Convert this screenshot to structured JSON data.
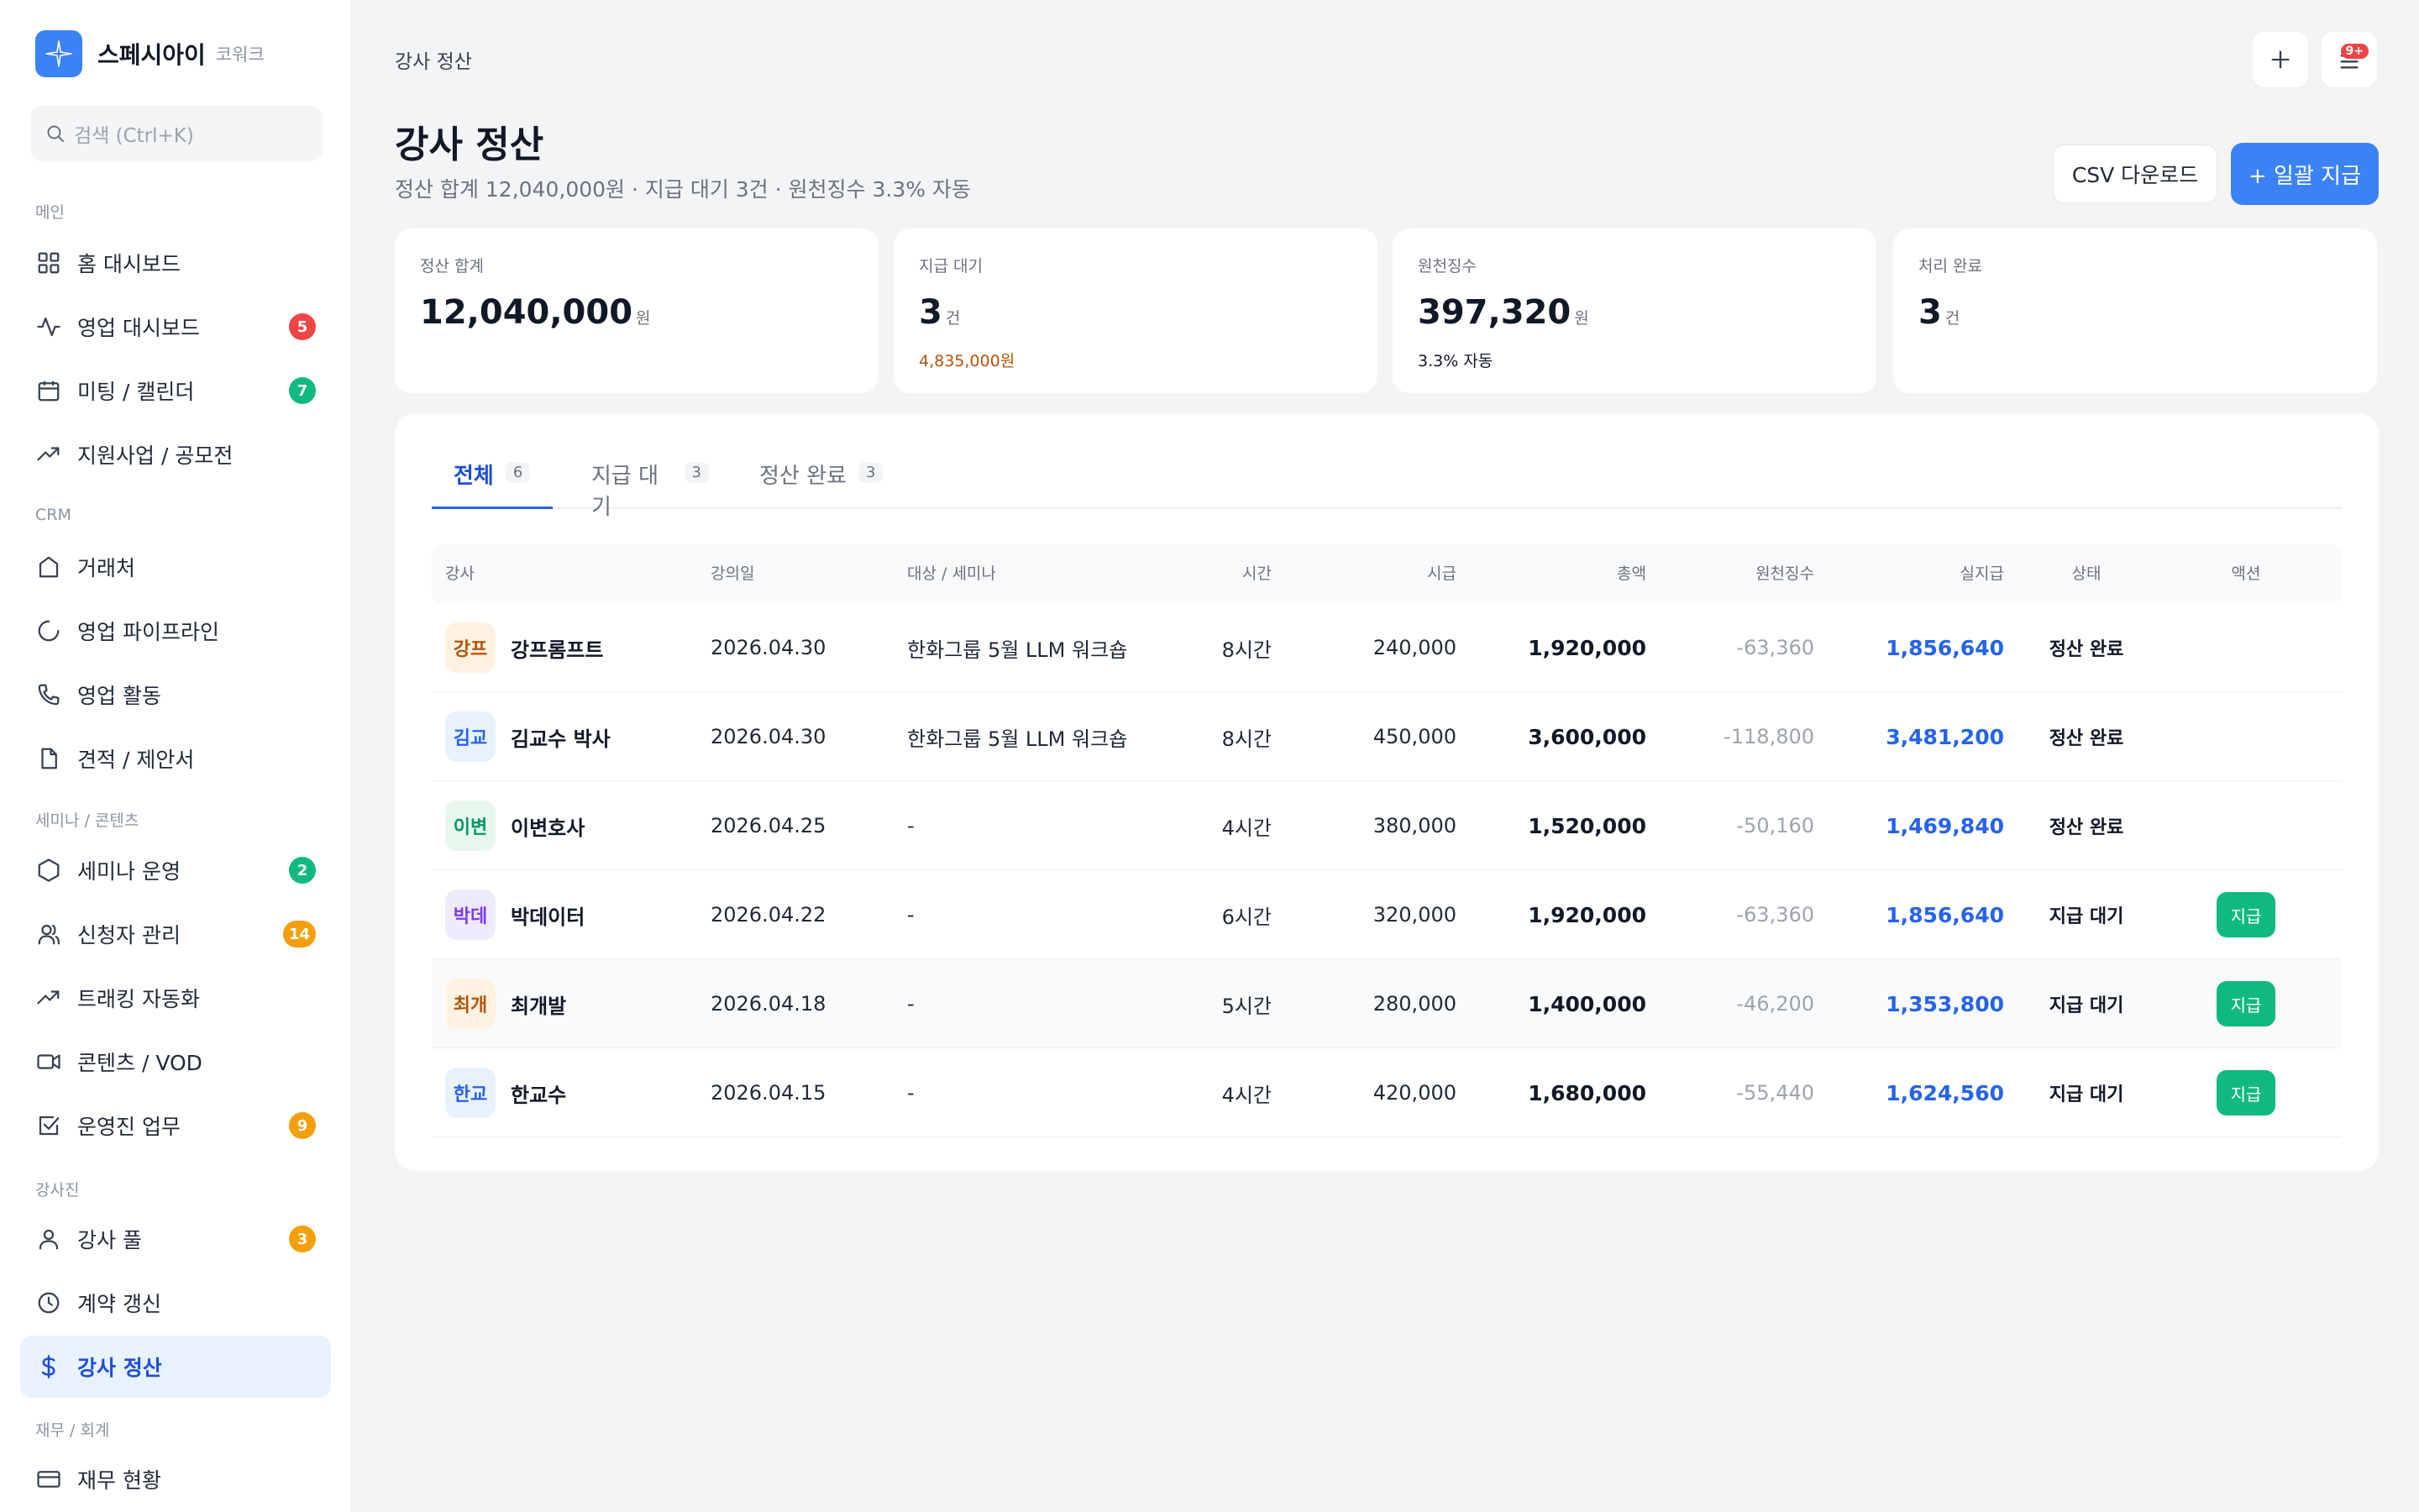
{
  "colors": {
    "accent": "#3b82f6",
    "active_bg": "#e8f1fe",
    "badge_red": "#ef4444",
    "badge_green": "#10b981",
    "badge_orange": "#f59e0b",
    "pay_green": "#10b981",
    "link_blue": "#2563eb"
  },
  "sidebar": {
    "brand": {
      "name": "스페시아이",
      "sub": "코워크",
      "icon": "sparkle-logo-icon"
    },
    "search": {
      "placeholder": "검색 (Ctrl+K)",
      "icon": "search-icon"
    },
    "groups": [
      "메인",
      "CRM",
      "세미나 / 콘텐츠",
      "강사진",
      "재무 / 회계"
    ],
    "items": [
      {
        "label": "홈 대시보드",
        "icon": "grid-icon"
      },
      {
        "label": "영업 대시보드",
        "icon": "activity-icon",
        "badge": "5"
      },
      {
        "label": "미팅 / 캘린더",
        "icon": "calendar-icon",
        "badge": "7"
      },
      {
        "label": "지원사업 / 공모전",
        "icon": "trending-up-icon"
      },
      {
        "label": "거래처",
        "icon": "building-icon"
      },
      {
        "label": "영업 파이프라인",
        "icon": "loading-circle-icon"
      },
      {
        "label": "영업 활동",
        "icon": "phone-icon"
      },
      {
        "label": "견적 / 제안서",
        "icon": "file-icon"
      },
      {
        "label": "세미나 운영",
        "icon": "hexagon-icon",
        "badge": "2"
      },
      {
        "label": "신청자 관리",
        "icon": "users-icon",
        "badge": "14"
      },
      {
        "label": "트래킹 자동화",
        "icon": "trending-up-icon"
      },
      {
        "label": "콘텐츠 / VOD",
        "icon": "video-icon"
      },
      {
        "label": "운영진 업무",
        "icon": "checkbox-icon",
        "badge": "9"
      },
      {
        "label": "강사 풀",
        "icon": "user-icon",
        "badge": "3"
      },
      {
        "label": "계약 갱신",
        "icon": "clock-icon"
      },
      {
        "label": "강사 정산",
        "icon": "dollar-icon",
        "active": true
      },
      {
        "label": "재무 현황",
        "icon": "credit-card-icon"
      }
    ]
  },
  "header": {
    "breadcrumb": "강사 정산",
    "add_icon": "plus-icon",
    "notifications": {
      "icon": "bell-icon",
      "badge": "9+"
    }
  },
  "page": {
    "title": "강사 정산",
    "subtitle": "정산 합계 12,040,000원 · 지급 대기 3건 · 원천징수 3.3% 자동",
    "csv_button": "CSV 다운로드",
    "primary_button": "+ 일괄 지급"
  },
  "stats": [
    {
      "label": "정산 합계",
      "value": "12,040,000",
      "unit": "원",
      "note": ""
    },
    {
      "label": "지급 대기",
      "value": "3",
      "unit": "건",
      "note": "4,835,000원"
    },
    {
      "label": "원천징수",
      "value": "397,320",
      "unit": "원",
      "note": "3.3% 자동"
    },
    {
      "label": "처리 완료",
      "value": "3",
      "unit": "건",
      "note": ""
    }
  ],
  "tabs": [
    {
      "label": "전체",
      "count": "6",
      "active": true
    },
    {
      "label": "지급 대기",
      "count": "3"
    },
    {
      "label": "정산 완료",
      "count": "3"
    }
  ],
  "table": {
    "columns": [
      "강사",
      "강의일",
      "대상 / 세미나",
      "시간",
      "시급",
      "총액",
      "원천징수",
      "실지급",
      "상태",
      "액션"
    ],
    "rows": [
      {
        "initials": "강프",
        "name": "강프롬프트",
        "date": "2026.04.30",
        "target": "한화그룹 5월 LLM 워크숍",
        "hours": "8시간",
        "rate": "240,000",
        "total": "1,920,000",
        "tax": "-63,360",
        "net": "1,856,640",
        "status": "정산 완료",
        "action": "",
        "avatar_bg": "#fef3e2",
        "avatar_fg": "#b45309"
      },
      {
        "initials": "김교",
        "name": "김교수 박사",
        "date": "2026.04.30",
        "target": "한화그룹 5월 LLM 워크숍",
        "hours": "8시간",
        "rate": "450,000",
        "total": "3,600,000",
        "tax": "-118,800",
        "net": "3,481,200",
        "status": "정산 완료",
        "action": "",
        "avatar_bg": "#e8f1fe",
        "avatar_fg": "#2563eb"
      },
      {
        "initials": "이변",
        "name": "이변호사",
        "date": "2026.04.25",
        "target": "-",
        "hours": "4시간",
        "rate": "380,000",
        "total": "1,520,000",
        "tax": "-50,160",
        "net": "1,469,840",
        "status": "정산 완료",
        "action": "",
        "avatar_bg": "#e6f7ee",
        "avatar_fg": "#059669"
      },
      {
        "initials": "박데",
        "name": "박데이터",
        "date": "2026.04.22",
        "target": "-",
        "hours": "6시간",
        "rate": "320,000",
        "total": "1,920,000",
        "tax": "-63,360",
        "net": "1,856,640",
        "status": "지급 대기",
        "action": "지급",
        "avatar_bg": "#efeafe",
        "avatar_fg": "#7c3aed"
      },
      {
        "initials": "최개",
        "name": "최개발",
        "date": "2026.04.18",
        "target": "-",
        "hours": "5시간",
        "rate": "280,000",
        "total": "1,400,000",
        "tax": "-46,200",
        "net": "1,353,800",
        "status": "지급 대기",
        "action": "지급",
        "avatar_bg": "#fef3e2",
        "avatar_fg": "#b45309"
      },
      {
        "initials": "한교",
        "name": "한교수",
        "date": "2026.04.15",
        "target": "-",
        "hours": "4시간",
        "rate": "420,000",
        "total": "1,680,000",
        "tax": "-55,440",
        "net": "1,624,560",
        "status": "지급 대기",
        "action": "지급",
        "avatar_bg": "#e8f1fe",
        "avatar_fg": "#2563eb"
      }
    ]
  }
}
